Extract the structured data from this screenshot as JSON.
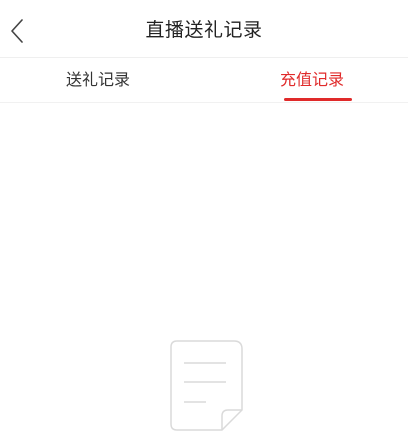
{
  "header": {
    "title": "直播送礼记录",
    "back_icon": "chevron-left-icon"
  },
  "tabs": [
    {
      "label": "送礼记录",
      "active": false
    },
    {
      "label": "充值记录",
      "active": true
    }
  ],
  "colors": {
    "accent": "#e02a2a",
    "text": "#333333",
    "divider": "#efefef",
    "empty_icon_stroke": "#d6d6d6"
  },
  "empty_state": {
    "icon": "document-icon"
  }
}
